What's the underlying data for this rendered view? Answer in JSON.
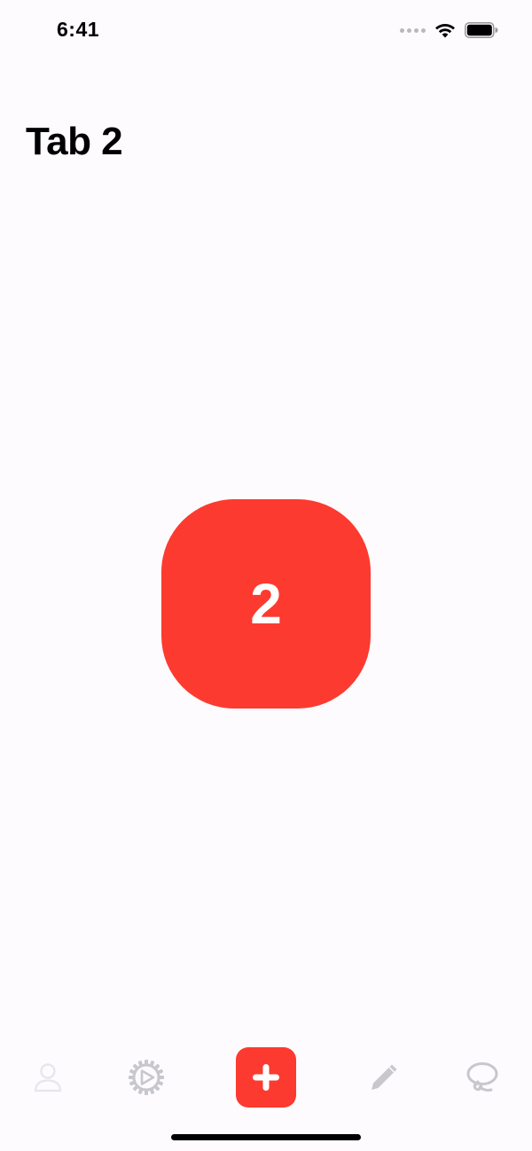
{
  "status_bar": {
    "time": "6:41"
  },
  "header": {
    "title": "Tab 2"
  },
  "main": {
    "tile_value": "2",
    "tile_color": "#fd3a30"
  },
  "tab_bar": {
    "items": [
      {
        "icon": "person-icon",
        "state": "inactive"
      },
      {
        "icon": "gear-play-icon",
        "state": "inactive"
      },
      {
        "icon": "plus-icon",
        "state": "active",
        "accent": "#fd3a30"
      },
      {
        "icon": "pencil-icon",
        "state": "inactive"
      },
      {
        "icon": "lasso-icon",
        "state": "inactive"
      }
    ]
  },
  "colors": {
    "accent": "#fd3a30",
    "background": "#fdfbfe",
    "icon_inactive": "#c7c7cc",
    "icon_faded": "#e5e5ea"
  }
}
